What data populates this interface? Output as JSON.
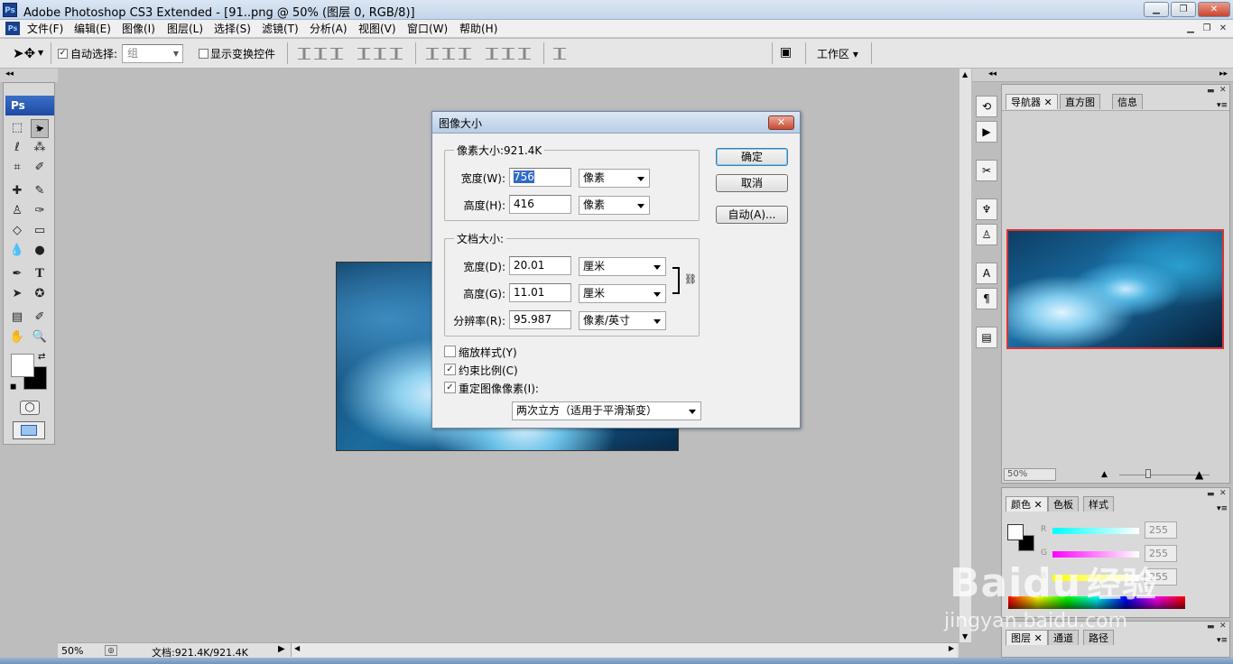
{
  "window": {
    "title": "Adobe Photoshop CS3 Extended - [91..png @ 50% (图层 0, RGB/8)]",
    "app_icon": "Ps"
  },
  "menu": [
    "文件(F)",
    "编辑(E)",
    "图像(I)",
    "图层(L)",
    "选择(S)",
    "滤镜(T)",
    "分析(A)",
    "视图(V)",
    "窗口(W)",
    "帮助(H)"
  ],
  "options": {
    "auto_select_label": "自动选择:",
    "auto_select_value": "组",
    "show_transform_label": "显示变换控件",
    "workspace_label": "工作区"
  },
  "toolbox": {
    "header": "Ps"
  },
  "status": {
    "zoom": "50%",
    "doc_info": "文档:921.4K/921.4K"
  },
  "dialog": {
    "title": "图像大小",
    "pixel_group": "像素大小:921.4K",
    "width_label": "宽度(W):",
    "width_value": "756",
    "width_unit": "像素",
    "height_label": "高度(H):",
    "height_value": "416",
    "height_unit": "像素",
    "doc_group": "文档大小:",
    "doc_width_label": "宽度(D):",
    "doc_width_value": "20.01",
    "doc_width_unit": "厘米",
    "doc_height_label": "高度(G):",
    "doc_height_value": "11.01",
    "doc_height_unit": "厘米",
    "res_label": "分辨率(R):",
    "res_value": "95.987",
    "res_unit": "像素/英寸",
    "scale_styles": "缩放样式(Y)",
    "constrain": "约束比例(C)",
    "resample": "重定图像像素(I):",
    "resample_method": "两次立方（适用于平滑渐变）",
    "ok": "确定",
    "cancel": "取消",
    "auto": "自动(A)...",
    "scale_styles_checked": false,
    "constrain_checked": true,
    "resample_checked": true
  },
  "navigator": {
    "tabs": [
      "导航器",
      "直方图",
      "信息"
    ],
    "zoom": "50%"
  },
  "color_panel": {
    "tabs": [
      "颜色",
      "色板",
      "样式"
    ],
    "r_label": "R",
    "g_label": "G",
    "b_label": "B",
    "r": "255",
    "g": "255",
    "b": "255"
  },
  "layers_panel": {
    "tabs": [
      "图层",
      "通道",
      "路径"
    ]
  },
  "watermark": {
    "brand": "Baidu",
    "cn": "经验",
    "url": "jingyan.baidu.com"
  }
}
